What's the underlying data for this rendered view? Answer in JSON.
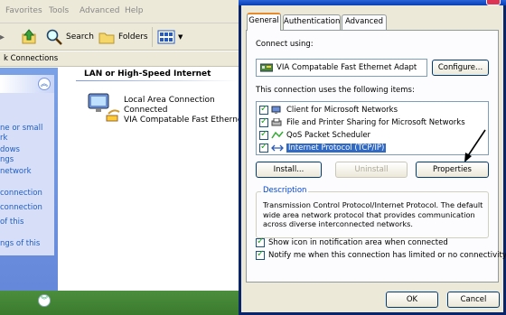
{
  "explorer": {
    "menu": [
      "Favorites",
      "Tools",
      "Advanced",
      "Help"
    ],
    "toolbar": {
      "search_label": "Search",
      "folders_label": "Folders"
    },
    "address_text": "k Connections",
    "left_links": [
      "ne or small",
      "rk",
      "dows",
      "ngs",
      "network",
      "connection",
      "connection",
      "of this",
      "ngs of this"
    ],
    "group_header": "LAN or High-Speed Internet",
    "connection": {
      "name": "Local Area Connection",
      "status": "Connected",
      "device": "VIA Compatable Fast Ethernet..."
    }
  },
  "dialog": {
    "tabs": [
      "General",
      "Authentication",
      "Advanced"
    ],
    "active_tab": "General",
    "connect_using_label": "Connect using:",
    "adapter_name": "VIA Compatable Fast Ethernet Adapt",
    "configure_label": "Configure...",
    "items_label": "This connection uses the following items:",
    "items": [
      {
        "label": "Client for Microsoft Networks",
        "checked": true,
        "selected": false
      },
      {
        "label": "File and Printer Sharing for Microsoft Networks",
        "checked": true,
        "selected": false
      },
      {
        "label": "QoS Packet Scheduler",
        "checked": true,
        "selected": false
      },
      {
        "label": "Internet Protocol (TCP/IP)",
        "checked": true,
        "selected": true
      }
    ],
    "install_label": "Install...",
    "uninstall_label": "Uninstall",
    "properties_label": "Properties",
    "description_legend": "Description",
    "description_text": "Transmission Control Protocol/Internet Protocol. The default wide area network protocol that provides communication across diverse interconnected networks.",
    "show_icon_label": "Show icon in notification area when connected",
    "notify_label": "Notify me when this connection has limited or no connectivity",
    "ok_label": "OK",
    "cancel_label": "Cancel"
  },
  "colors": {
    "selection": "#316ac5",
    "link": "#215dc6",
    "dialog_face": "#ece9d8",
    "tab_accent": "#e68b2c"
  }
}
